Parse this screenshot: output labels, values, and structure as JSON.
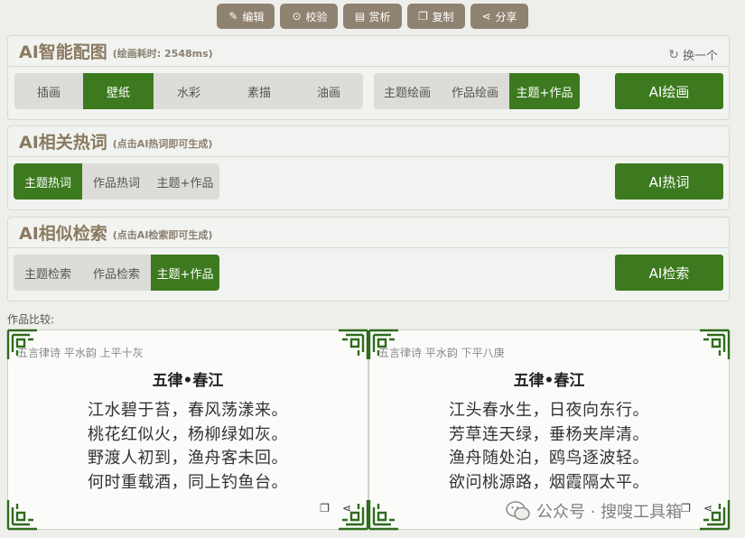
{
  "toolbar": {
    "edit": "编辑",
    "verify": "校验",
    "appreciate": "赏析",
    "copy": "复制",
    "share": "分享"
  },
  "ai_paint": {
    "title": "AI智能配图",
    "subtitle": "(绘画耗时: 2548ms)",
    "swap_label": "换一个",
    "styles": [
      "插画",
      "壁纸",
      "水彩",
      "素描",
      "油画"
    ],
    "active_style": "壁纸",
    "sources": [
      "主题绘画",
      "作品绘画",
      "主题+作品"
    ],
    "active_source": "主题+作品",
    "action": "AI绘画"
  },
  "ai_hotwords": {
    "title": "AI相关热词",
    "subtitle": "(点击AI热词即可生成)",
    "options": [
      "主题热词",
      "作品热词",
      "主题+作品"
    ],
    "active": "主题热词",
    "action": "AI热词"
  },
  "ai_search": {
    "title": "AI相似检索",
    "subtitle": "(点击AI检索即可生成)",
    "options": [
      "主题检索",
      "作品检索",
      "主题+作品"
    ],
    "active": "主题+作品",
    "action": "AI检索"
  },
  "compare": {
    "label": "作品比较:",
    "cards": [
      {
        "meta": "五言律诗 平水韵 上平十灰",
        "title": "五律•春江",
        "lines": [
          "江水碧于苔，春风荡漾来。",
          "桃花红似火，杨柳绿如灰。",
          "野渡人初到，渔舟客未回。",
          "何时重载酒，同上钓鱼台。"
        ]
      },
      {
        "meta": "五言律诗 平水韵 下平八庚",
        "title": "五律•春江",
        "lines": [
          "江头春水生，日夜向东行。",
          "芳草连天绿，垂杨夹岸清。",
          "渔舟随处泊，鸥鸟逐波轻。",
          "欲问桃源路，烟霞隔太平。"
        ]
      }
    ]
  },
  "watermark": "公众号 · 搜嗖工具箱",
  "colors": {
    "accent": "#3d7a1f",
    "toolbar_button": "#8f8270",
    "title": "#8a7a60"
  }
}
